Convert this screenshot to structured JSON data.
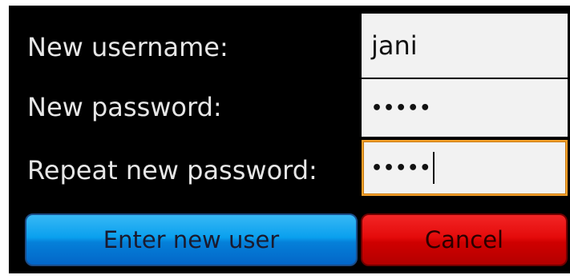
{
  "form": {
    "username_label": "New username:",
    "password_label": "New password:",
    "repeat_label": "Repeat new password:",
    "username_value": "jani",
    "password_mask": "•••••",
    "repeat_mask": "•••••"
  },
  "buttons": {
    "enter_label": "Enter new user",
    "cancel_label": "Cancel"
  },
  "colors": {
    "background": "#000000",
    "focus_border": "#f5a02a",
    "enter_button": "#0aa0ee",
    "cancel_button": "#e40b0b"
  }
}
